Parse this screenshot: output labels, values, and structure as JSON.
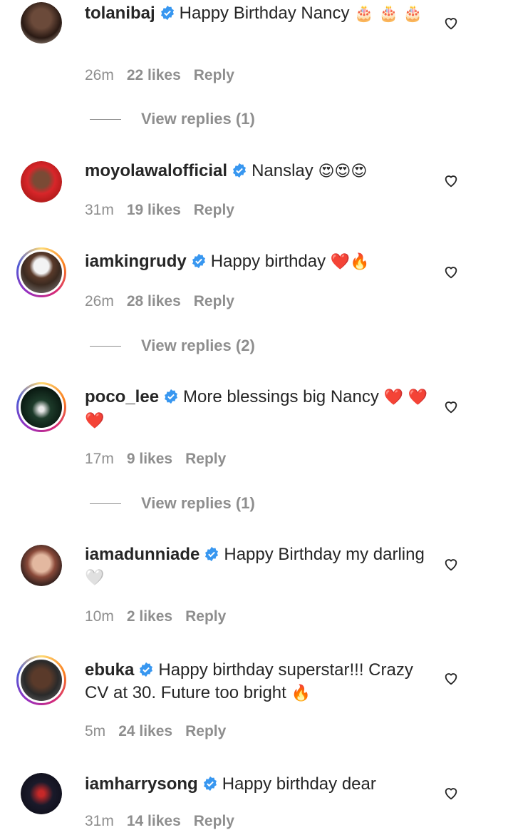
{
  "comments": [
    {
      "username": "tolanibaj",
      "text": "Happy Birthday Nancy",
      "emoji": "🎂 🎂 🎂",
      "time": "26m",
      "likes": "22 likes",
      "reply": "Reply",
      "view_replies": "View replies (1)"
    },
    {
      "username": "moyolawalofficial",
      "text": "Nanslay",
      "emoji": "😍😍😍",
      "time": "31m",
      "likes": "19 likes",
      "reply": "Reply"
    },
    {
      "username": "iamkingrudy",
      "text": "Happy birthday",
      "emoji": "❤️🔥",
      "time": "26m",
      "likes": "28 likes",
      "reply": "Reply",
      "view_replies": "View replies (2)"
    },
    {
      "username": "poco_lee",
      "text": "More blessings big Nancy",
      "emoji": "❤️ ❤️❤️",
      "time": "17m",
      "likes": "9 likes",
      "reply": "Reply",
      "view_replies": "View replies (1)"
    },
    {
      "username": "iamadunniade",
      "text": "Happy Birthday my darling",
      "emoji": "🤍",
      "time": "10m",
      "likes": "2 likes",
      "reply": "Reply"
    },
    {
      "username": "ebuka",
      "text": "Happy birthday superstar!!! Crazy CV at 30. Future too bright",
      "emoji": "🔥",
      "time": "5m",
      "likes": "24 likes",
      "reply": "Reply"
    },
    {
      "username": "iamharrysong",
      "text": "Happy birthday dear",
      "emoji": "",
      "time": "31m",
      "likes": "14 likes",
      "reply": "Reply"
    }
  ],
  "icons": {
    "heart": "heart-outline-icon",
    "verified": "verified-badge-icon"
  },
  "colors": {
    "verified": "#3897f0",
    "meta_text": "#8e8e8e",
    "primary_text": "#262626"
  }
}
